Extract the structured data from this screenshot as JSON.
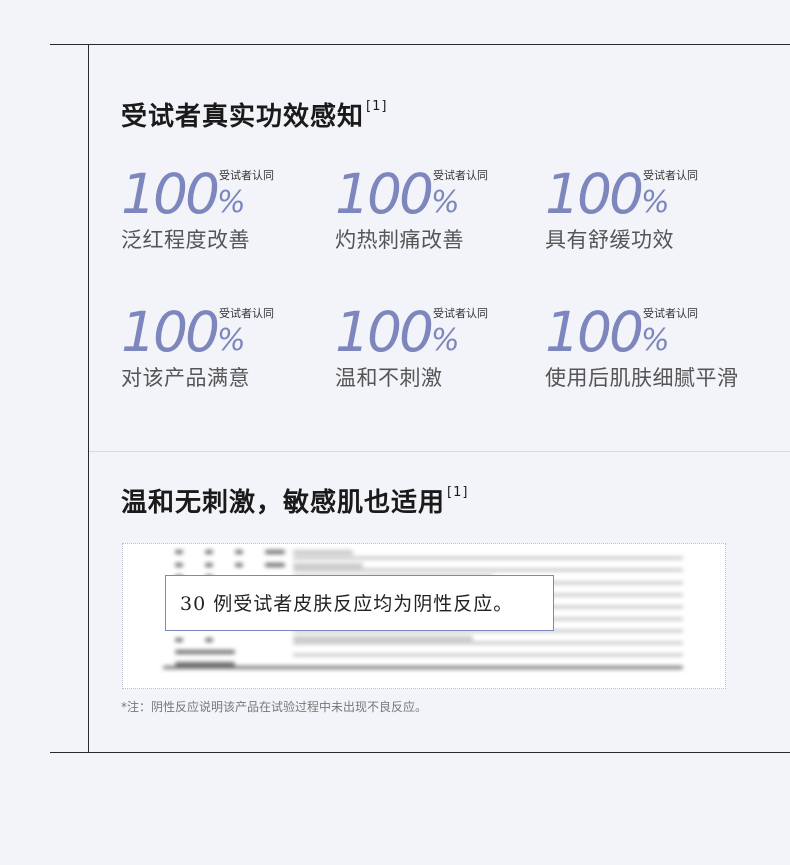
{
  "section1": {
    "title": "受试者真实功效感知",
    "ref": "[1]",
    "stats": [
      {
        "value": "100",
        "unit": "%",
        "tag": "受试者认同",
        "label": "泛红程度改善"
      },
      {
        "value": "100",
        "unit": "%",
        "tag": "受试者认同",
        "label": "灼热刺痛改善"
      },
      {
        "value": "100",
        "unit": "%",
        "tag": "受试者认同",
        "label": "具有舒缓功效"
      },
      {
        "value": "100",
        "unit": "%",
        "tag": "受试者认同",
        "label": "对该产品满意"
      },
      {
        "value": "100",
        "unit": "%",
        "tag": "受试者认同",
        "label": "温和不刺激"
      },
      {
        "value": "100",
        "unit": "%",
        "tag": "受试者认同",
        "label": "使用后肌肤细腻平滑"
      }
    ]
  },
  "section2": {
    "title": "温和无刺激，敏感肌也适用",
    "ref": "[1]",
    "callout": "30 例受试者皮肤反应均为阴性反应。",
    "footnote": "*注：阴性反应说明该产品在试验过程中未出现不良反应。"
  },
  "colors": {
    "accent": "#7d86bd",
    "background": "#f3f4f9",
    "frame": "#2b2b2b"
  }
}
